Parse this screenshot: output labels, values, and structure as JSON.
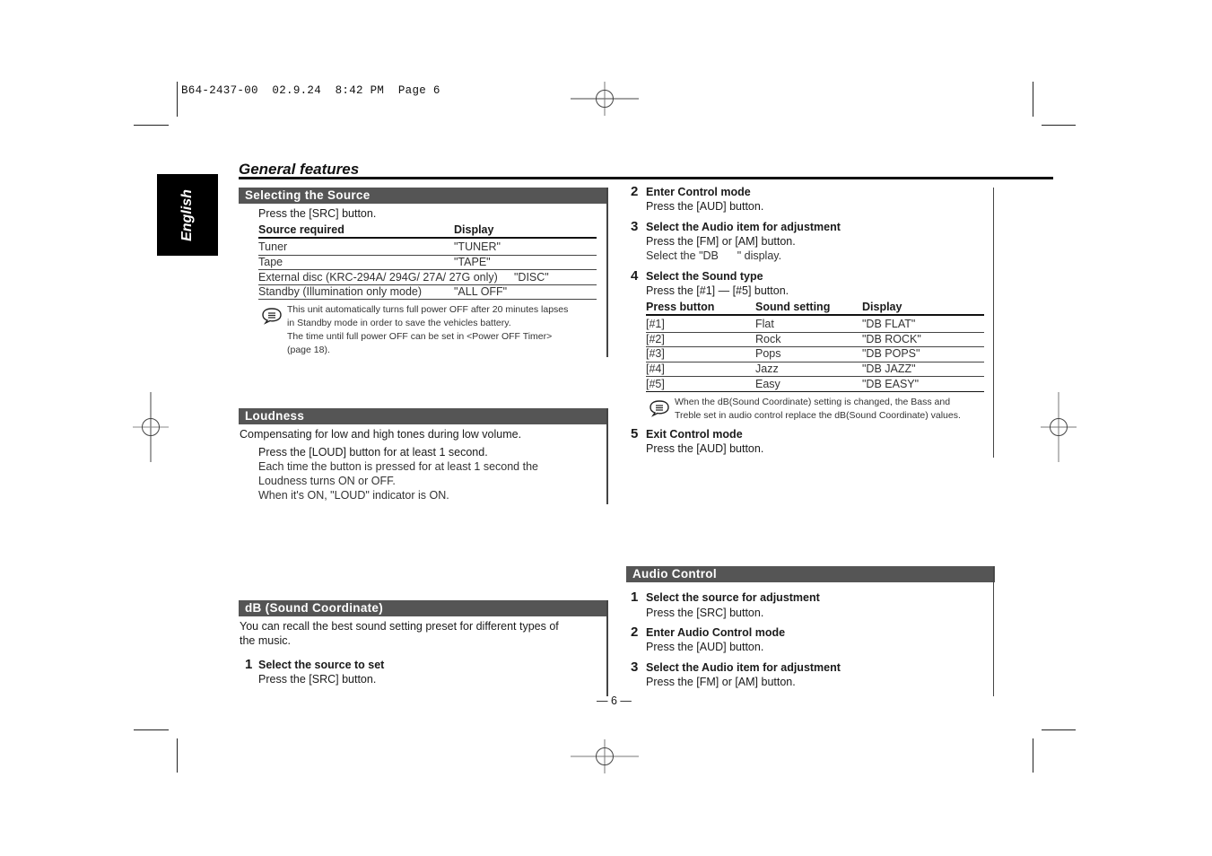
{
  "print_header": "B64-2437-00  02.9.24  8:42 PM  Page 6",
  "language_tab": "English",
  "page_title": "General features",
  "page_number": "— 6 —",
  "left_column": {
    "selecting_source": {
      "heading": "Selecting the Source",
      "instruction": "Press the [SRC] button.",
      "table": {
        "headers": [
          "Source required",
          "Display"
        ],
        "rows": [
          [
            "Tuner",
            "\"TUNER\""
          ],
          [
            "Tape",
            "\"TAPE\""
          ],
          [
            "External disc (KRC-294A/ 294G/ 27A/ 27G only)",
            "\"DISC\""
          ],
          [
            "Standby (Illumination only mode)",
            "\"ALL OFF\""
          ]
        ]
      },
      "note_lines": [
        "This unit automatically turns full power OFF after 20 minutes lapses",
        "in Standby mode in order to save the vehicles battery.",
        "The time until full power OFF can be set in <Power OFF Timer>",
        "(page 18)."
      ]
    },
    "loudness": {
      "heading": "Loudness",
      "intro": "Compensating for low and high tones during low volume.",
      "instruction": "Press the [LOUD] button for at least 1 second.",
      "detail_lines": [
        "Each time the button is pressed for at least 1 second the",
        "Loudness turns ON or OFF.",
        "When it's ON, \"LOUD\" indicator is ON."
      ]
    },
    "db_sound": {
      "heading": "dB (Sound Coordinate)",
      "intro_lines": [
        "You can recall the best sound setting preset for different types of",
        "the music."
      ],
      "step1": {
        "num": "1",
        "title": "Select the source to set",
        "text": "Press the [SRC] button."
      }
    }
  },
  "right_column": {
    "steps": [
      {
        "num": "2",
        "title": "Enter Control mode",
        "text": "Press the [AUD] button."
      },
      {
        "num": "3",
        "title": "Select the Audio item for adjustment",
        "text": "Press the [FM] or [AM] button.",
        "sub": "Select the \"DB      \" display."
      },
      {
        "num": "4",
        "title": "Select the Sound type",
        "text": "Press the [#1] — [#5] button."
      }
    ],
    "sound_table": {
      "headers": [
        "Press button",
        "Sound setting",
        "Display"
      ],
      "rows": [
        [
          "[#1]",
          "Flat",
          "\"DB FLAT\""
        ],
        [
          "[#2]",
          "Rock",
          "\"DB ROCK\""
        ],
        [
          "[#3]",
          "Pops",
          "\"DB POPS\""
        ],
        [
          "[#4]",
          "Jazz",
          "\"DB JAZZ\""
        ],
        [
          "[#5]",
          "Easy",
          "\"DB EASY\""
        ]
      ]
    },
    "note_lines": [
      "When the dB(Sound Coordinate) setting is changed, the Bass and",
      "Treble set in audio control replace the dB(Sound Coordinate) values."
    ],
    "step5": {
      "num": "5",
      "title": "Exit Control mode",
      "text": "Press the [AUD] button."
    },
    "audio_control": {
      "heading": "Audio Control",
      "steps": [
        {
          "num": "1",
          "title": "Select the source for adjustment",
          "text": "Press the [SRC] button."
        },
        {
          "num": "2",
          "title": "Enter Audio Control mode",
          "text": "Press the [AUD] button."
        },
        {
          "num": "3",
          "title": "Select the Audio item for adjustment",
          "text": "Press the [FM] or [AM] button."
        }
      ]
    }
  }
}
